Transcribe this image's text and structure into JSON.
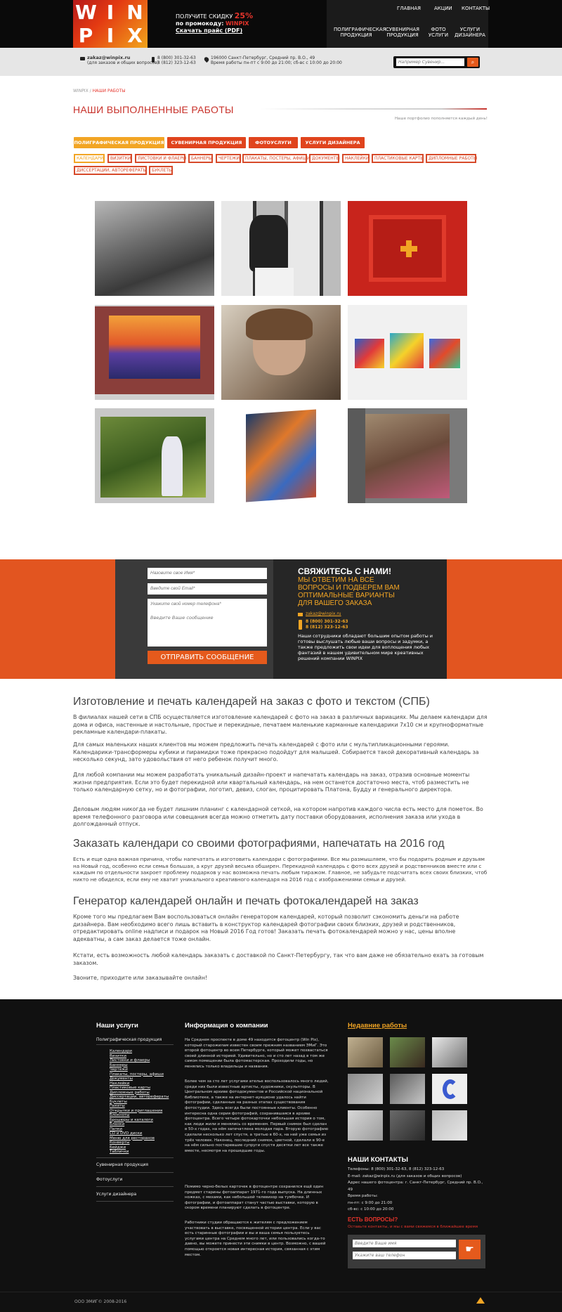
{
  "header": {
    "logo": [
      "W",
      "I",
      "N",
      "P",
      "I",
      "X"
    ],
    "promo_line1": "ПОЛУЧИТЕ СКИДКУ",
    "promo_pct": "25%",
    "promo_line2": "по промокоду:",
    "promo_code": "WINPIX",
    "promo_price": "Скачать прайс (PDF)",
    "nav_top": [
      "ГЛАВНАЯ",
      "АКЦИИ",
      "КОНТАКТЫ"
    ],
    "nav_bottom": [
      [
        "ПОЛИГРАФИЧЕСКАЯ",
        "ПРОДУКЦИЯ"
      ],
      [
        "СУВЕНИРНАЯ",
        "ПРОДУКЦИЯ"
      ],
      [
        "ФОТО",
        "УСЛУГИ"
      ],
      [
        "УСЛУГИ",
        "ДИЗАЙНЕРА"
      ]
    ]
  },
  "contactbar": {
    "email": "zakaz@winpix.ru",
    "email_note": "(для заказов и общих вопросов)",
    "phone1": "8 (800) 301-32-63",
    "phone2": "8 (812) 323-12-63",
    "address": "196000 Санкт-Петербург, Средний пр. В.О., 49",
    "hours": "Время работы пн-пт с 9:00 до 21:00; сб-вс с 10:00 до 20:00",
    "search_placeholder": "Например Сувенир...",
    "search_icon": "magnifier"
  },
  "breadcrumb": {
    "home": "WINPIX",
    "sep": "/",
    "current": "НАШИ РАБОТЫ"
  },
  "page_title": "НАШИ ВЫПОЛНЕННЫЕ РАБОТЫ",
  "title_note": "Наше портфолио пополняется каждый день!",
  "tabs": [
    "ПОЛИГРАФИЧЕСКАЯ ПРОДУКЦИЯ",
    "СУВЕНИРНАЯ ПРОДУКЦИЯ",
    "ФОТОУСЛУГИ",
    "УСЛУГИ ДИЗАЙНЕРА"
  ],
  "subtags": [
    "КАЛЕНДАРИ",
    "ВИЗИТКИ",
    "ЛИСТОВКИ И ФЛАЕРЫ",
    "БАННЕРЫ",
    "ЧЕРТЕЖИ",
    "ПЛАКАТЫ, ПОСТЕРЫ, АФИШИ",
    "ДОКУМЕНТЫ",
    "НАКЛЕЙКИ",
    "ПЛАСТИКОВЫЕ КАРТЫ",
    "ДИПЛОМНЫЕ РАБОТЫ",
    "ДИССЕРТАЦИИ, АВТОРЕФЕРАТЫ",
    "БУКЛЕТЫ"
  ],
  "form": {
    "name": "Назовите свое Имя*",
    "email": "Введите свой Email*",
    "phone": "Укажите свой номер телефона*",
    "message": "Введите Ваше сообщение",
    "send": "ОТПРАВИТЬ СООБЩЕНИЕ",
    "heading": "СВЯЖИТЕСЬ С НАМИ!",
    "sub": "МЫ ОТВЕТИМ НА ВСЕ ВОПРОСЫ И ПОДБЕРЕМ ВАМ ОПТИМАЛЬНЫЕ ВАРИАНТЫ ДЛЯ ВАШЕГО ЗАКАЗА",
    "email_val": "zakaz@winpix.ru",
    "phone1": "8 (800) 301-32-63",
    "phone2": "8 (812) 323-12-63",
    "text": "Наши сотрудники обладают большим опытом работы и готовы выслушать любые ваши вопросы и задумки, а также предложить свои идеи для воплощения любых фантазий в нашем удивительном мире креативных решений компании WINPIX"
  },
  "article": {
    "h1": "Изготовление и печать календарей на заказ с фото и текстом (СПБ)",
    "p1": "В филиалах нашей сети в СПБ осуществляется изготовление календарей с фото на заказ в различных вариациях. Мы делаем календари для дома и офиса, настенные и настольные, простые и перекидные, печатаем маленькие карманные календарики 7х10 см и крупноформатные рекламные календари-плакаты.",
    "p2": "Для самых маленьких наших клиентов мы можем предложить печать календарей с фото или с мультипликационными героями. Календарики-трансформеры  кубики и пирамидки  тоже прекрасно подойдут для малышей. Собирается такой декоративный календарь за несколько секунд, зато удовольствия от него ребенок получит много.",
    "p3": "Для любой компании мы можем разработать уникальный дизайн-проект и напечатать календарь на заказ, отразив основные моменты жизни предприятия. Если  это будет перекидной или квартальный календарь, на нем останется достаточно места, чтоб разместить не только календарную сетку, но и фотографии, логотип, девиз, слоган, процитировать Платона, Будду и генерального директора.",
    "p4": "Деловым людям никогда не будет лишним планинг с календарной сеткой, на котором напротив каждого числа есть место для пометок. Во время телефонного разговора или совещания всегда можно отметить дату поставки оборудования, исполнения заказа или ухода в долгожданный отпуск.",
    "h2": "Заказать календари со своими фотографиями, напечатать на 2016 год",
    "p5": "Есть и еще одна важная причина, чтобы напечатать и изготовить календари с фотографиями. Все мы размышляем, что бы подарить родным и друзьям на Новый год, особенно если семья большая, а круг друзей весьма обширен. Перекидной календарь с фото всех друзей и родственников вместе или с каждым по отдельности закроет проблему подарков  у нас возможна печать любым тиражом. Главное, не забудьте подсчитать всех своих близких, чтоб никто не обиделся, если ему не хватит уникального креативного календаря на 2016 год с изображениями семьи и друзей.",
    "h3": "Генератор календарей онлайн и печать фотокалендарей на заказ",
    "p6": "Кроме того мы предлагаем Вам воспользоваться онлайн генератором календарей, который позволит сэкономить деньги на работе дизайнера. Вам необходимо всего лишь вставить в конструктор календарей фотографии своих близких, друзей и родственников, отредактировать online надписи и подарок на Новый 2016 Год готов! Заказать печать фотокалендарей можно у нас,  цены вполне адекватны, а сам заказ делается тоже онлайн.",
    "p7": "Кстати, есть возможность любой календарь заказать с доставкой по Санкт-Петербургу, так что вам даже не обязательно ехать за готовым заказом.",
    "p8": "Звоните, приходите или заказывайте онлайн!"
  },
  "footer": {
    "services_title": "Наши услуги",
    "services_main": "Полиграфическая продукция",
    "services_list": [
      "Календари",
      "Визитки",
      "Листовки и флаеры",
      "Баннеры",
      "Чертежи",
      "Плакаты, постеры, афиши",
      "Документы",
      "Наклейки",
      "Пластиковые карты",
      "Дипломные работы",
      "Диссертации, авторефераты",
      "Буклеты",
      "Пакеты",
      "Открытки и приглашения",
      "Блокноты",
      "Брошюры и каталоги",
      "Бланки",
      "Папки",
      "CD и DVD диски",
      "Меню для ресторанов",
      "Конверты",
      "Бейджи",
      "Таблички"
    ],
    "services_other": [
      "Сувенирная продукция",
      "Фотоуслуги",
      "Услуги дизайнера"
    ],
    "info_title": "Информация о компании",
    "info_p1": "На Среднем проспекте в доме 49 находится фотоцентр (Win Pix), который старожилам известен своим прежним названием ЭМиГ. Это второй фотоцентр во всем Петербурге, который может похвастаться своей длинной историей. Удивительно, но и сто лет назад в том же самом помещении была фотомастерская. Проходили годы, но менялись только владельцы и названия.",
    "info_p2": "Более чем за сто лет услугами ателье воспользовалось много людей, среди них были известные артисты, художники, скульпторы. В Центральном архиве фотодокументов и Российской национальной библиотеке, а также на интернет-аукционе удалось найти фотографии, сделанные на разных этапах существования фотостудии. Здесь всегда были постоянные клиенты. Особенно интересна одна серия фотографий, сохранившаяся в архиве фотоцентра. Всего четыре фотокарточки  небольшая история о том, как люди жили и менялись со временем. Первый снимок был сделан в 50-х годах, на нём запечатлена молодая пара. Вторую фотографию сделали несколько лет спустя, а третью в 60-х, на ней уже семья из трёх человек. Наконец, последний снимок, цветной, сделали в 90-е  на нём сильно постаревшие супруги спустя десятки лет все также вместе, несмотря на прошедшие годы.",
    "info_p3": "Помимо черно-белых карточек в фотоцентре сохранился ещё один предмет старины  фотоаппарат 1971-го года выпуска. На длинных ножках, с мехами, как небольшой телевизор на тумбочке. И фотографии, и фотоаппарат станут частью выставки, которую в скором времени планируют сделать в фотоцентре.",
    "info_p4": "Работники студии обращаются к жителям с предложением участвовать в выставке, посвященной истории центра. Если у вас есть старинные фотографии и вы и ваша семья пользуетесь услугами центра на Среднем много лет, или пользовались когда-то давно, вы можете принести эти снимки в центр. Возможно, с вашей помощью откроется новая интересная история, связанная с этим местом.",
    "recent_title": "Недавние работы",
    "contacts_title": "НАШИ КОНТАКТЫ",
    "contacts": [
      "Телефоны: 8 (800) 301-32-63, 8 (812) 323-12-63",
      "E-mail: zakaz@winpix.ru (для заказов и общих вопросов)",
      "Адрес нашего фотоцентра: г. Санкт-Петербург, Средний пр. В.О., 49",
      "Время работы:",
      "пн-пт: с 9:00 до 21:00",
      "сб-вс: с 10:00 до 20:00"
    ],
    "ask_title": "ЕСТЬ ВОПРОСЫ?",
    "ask_text": "Оставьте контакты, и мы с вами свяжемся в ближайшее время",
    "ask_name": "Введите Ваше имя",
    "ask_phone": "Укажите ваш телефон",
    "copyright": "ООО ЭМИГ© 2008-2016"
  },
  "colors": {
    "accent": "#e5342b",
    "orange": "#e25520",
    "yellow": "#f2a524",
    "dark": "#111111"
  }
}
